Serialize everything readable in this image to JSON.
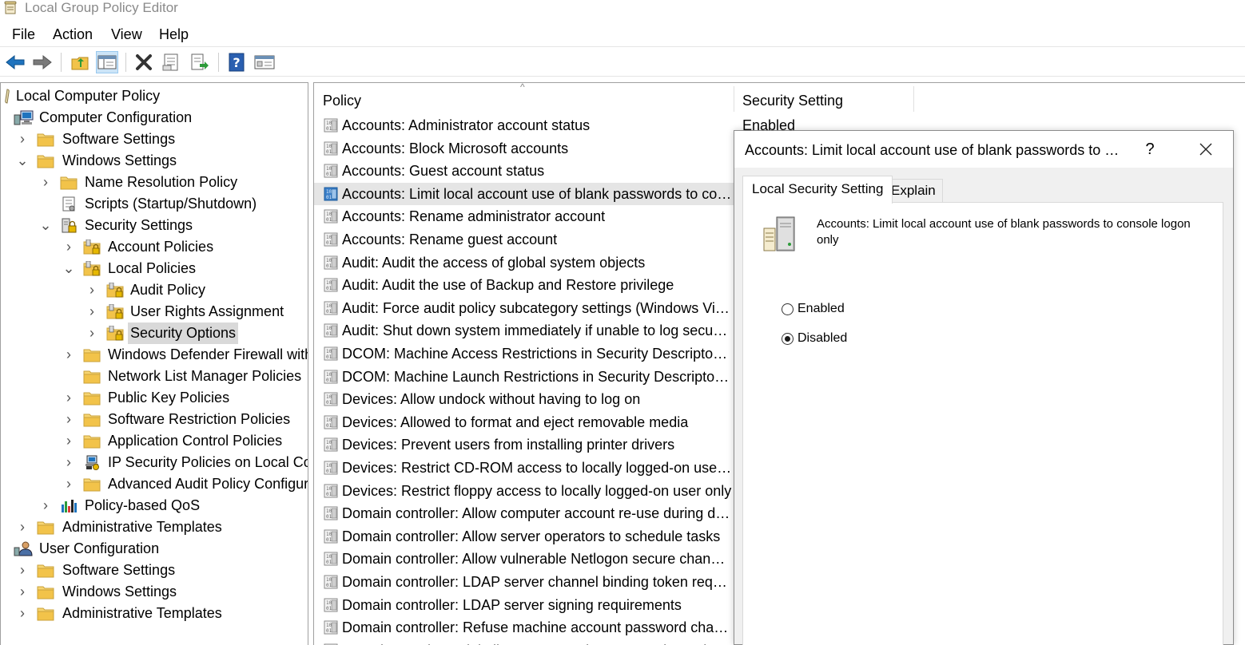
{
  "window": {
    "title": "Local Group Policy Editor"
  },
  "menu": [
    "File",
    "Action",
    "View",
    "Help"
  ],
  "toolbar": {
    "icons": [
      "back-arrow-icon",
      "forward-arrow-icon",
      "up-folder-icon",
      "show-hide-tree-icon",
      "delete-icon",
      "properties-icon",
      "export-list-icon",
      "help-icon",
      "extended-view-icon"
    ]
  },
  "tree": {
    "items": [
      {
        "label": "Local Computer Policy",
        "icon": "scroll-icon",
        "chevron": ""
      },
      {
        "label": "Computer Configuration",
        "icon": "computer-icon",
        "chevron": ""
      },
      {
        "label": "Software Settings",
        "icon": "folder-icon",
        "chevron": "›"
      },
      {
        "label": "Windows Settings",
        "icon": "folder-icon",
        "chevron": "⌄"
      },
      {
        "label": "Name Resolution Policy",
        "icon": "folder-icon",
        "chevron": "›"
      },
      {
        "label": "Scripts (Startup/Shutdown)",
        "icon": "script-icon",
        "chevron": ""
      },
      {
        "label": "Security Settings",
        "icon": "security-settings-icon",
        "chevron": "⌄"
      },
      {
        "label": "Account Policies",
        "icon": "locked-folder-icon",
        "chevron": "›"
      },
      {
        "label": "Local Policies",
        "icon": "locked-folder-icon",
        "chevron": "⌄"
      },
      {
        "label": "Audit Policy",
        "icon": "locked-folder-icon",
        "chevron": "›"
      },
      {
        "label": "User Rights Assignment",
        "icon": "locked-folder-icon",
        "chevron": "›"
      },
      {
        "label": "Security Options",
        "icon": "locked-folder-icon",
        "chevron": "›"
      },
      {
        "label": "Windows Defender Firewall with",
        "icon": "folder-icon",
        "chevron": "›"
      },
      {
        "label": "Network List Manager Policies",
        "icon": "folder-icon",
        "chevron": ""
      },
      {
        "label": "Public Key Policies",
        "icon": "folder-icon",
        "chevron": "›"
      },
      {
        "label": "Software Restriction Policies",
        "icon": "folder-icon",
        "chevron": "›"
      },
      {
        "label": "Application Control Policies",
        "icon": "folder-icon",
        "chevron": "›"
      },
      {
        "label": "IP Security Policies on Local Com",
        "icon": "ip-security-icon",
        "chevron": "›"
      },
      {
        "label": "Advanced Audit Policy Configura",
        "icon": "folder-icon",
        "chevron": "›"
      },
      {
        "label": "Policy-based QoS",
        "icon": "bar-chart-icon",
        "chevron": "›"
      },
      {
        "label": "Administrative Templates",
        "icon": "folder-icon",
        "chevron": "›"
      },
      {
        "label": "User Configuration",
        "icon": "user-icon",
        "chevron": ""
      },
      {
        "label": "Software Settings",
        "icon": "folder-icon",
        "chevron": "›"
      },
      {
        "label": "Windows Settings",
        "icon": "folder-icon",
        "chevron": "›"
      },
      {
        "label": "Administrative Templates",
        "icon": "folder-icon",
        "chevron": "›"
      }
    ]
  },
  "list": {
    "columns": {
      "policy": "Policy",
      "setting": "Security Setting"
    },
    "sort_indicator": "^",
    "first_setting": "Enabled",
    "rows": [
      "Accounts: Administrator account status",
      "Accounts: Block Microsoft accounts",
      "Accounts: Guest account status",
      "Accounts: Limit local account use of blank passwords to cons...",
      "Accounts: Rename administrator account",
      "Accounts: Rename guest account",
      "Audit: Audit the access of global system objects",
      "Audit: Audit the use of Backup and Restore privilege",
      "Audit: Force audit policy subcategory settings (Windows Vista...",
      "Audit: Shut down system immediately if unable to log securit...",
      "DCOM: Machine Access Restrictions in Security Descriptor Def...",
      "DCOM: Machine Launch Restrictions in Security Descriptor De...",
      "Devices: Allow undock without having to log on",
      "Devices: Allowed to format and eject removable media",
      "Devices: Prevent users from installing printer drivers",
      "Devices: Restrict CD-ROM access to locally logged-on user on...",
      "Devices: Restrict floppy access to locally logged-on user only",
      "Domain controller: Allow computer account re-use during do...",
      "Domain controller: Allow server operators to schedule tasks",
      "Domain controller: Allow vulnerable Netlogon secure channel...",
      "Domain controller: LDAP server channel binding token requir...",
      "Domain controller: LDAP server signing requirements",
      "Domain controller: Refuse machine account password changes",
      "Domain member: Digitally encrypt or sign secure channel data"
    ]
  },
  "dialog": {
    "title": "Accounts: Limit local account use of blank passwords to c...",
    "help_label": "?",
    "tabs": [
      "Local Security Setting",
      "Explain"
    ],
    "description": "Accounts: Limit local account use of blank passwords to console logon only",
    "options": [
      {
        "label": "Enabled",
        "checked": false
      },
      {
        "label": "Disabled",
        "checked": true
      }
    ]
  },
  "colors": {
    "selection_tree": "#d9d9d9",
    "selection_list": "#e5e5e5",
    "dialog_bg": "#f0f0f0",
    "folder": "#f2c34a",
    "accent_blue": "#1e73be"
  }
}
